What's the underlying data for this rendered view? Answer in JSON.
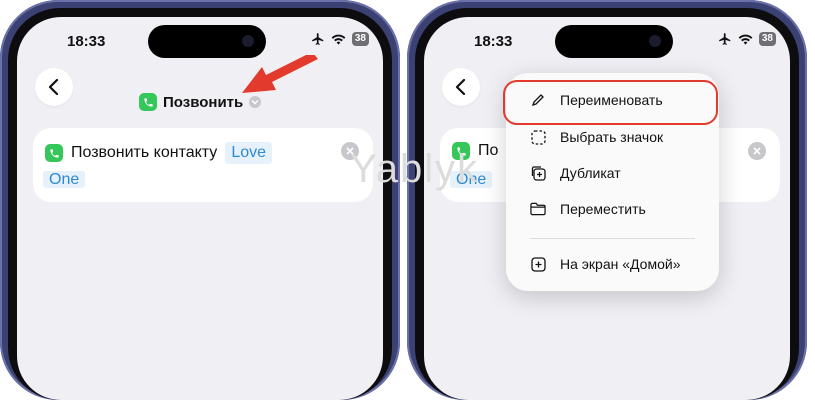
{
  "status_bar": {
    "time": "18:33",
    "battery": "38"
  },
  "left_screen": {
    "header_title": "Позвонить",
    "action": {
      "label": "Позвонить контакту",
      "token_part1": "Love",
      "token_part2": "One"
    }
  },
  "right_screen": {
    "partial_label": "По",
    "partial_token": "One"
  },
  "context_menu": {
    "items": [
      {
        "label": "Переименовать",
        "icon": "pencil-icon"
      },
      {
        "label": "Выбрать значок",
        "icon": "dashed-square-icon"
      },
      {
        "label": "Дубликат",
        "icon": "duplicate-icon"
      },
      {
        "label": "Переместить",
        "icon": "folder-icon"
      },
      {
        "label": "На экран «Домой»",
        "icon": "add-square-icon"
      }
    ]
  },
  "watermark": "Yablyk",
  "colors": {
    "phone_frame": "#3c4173",
    "screen_bg": "#efeff4",
    "app_green": "#35c759",
    "token_blue": "#2d8ad0",
    "annotation_red": "#e23a2c"
  }
}
